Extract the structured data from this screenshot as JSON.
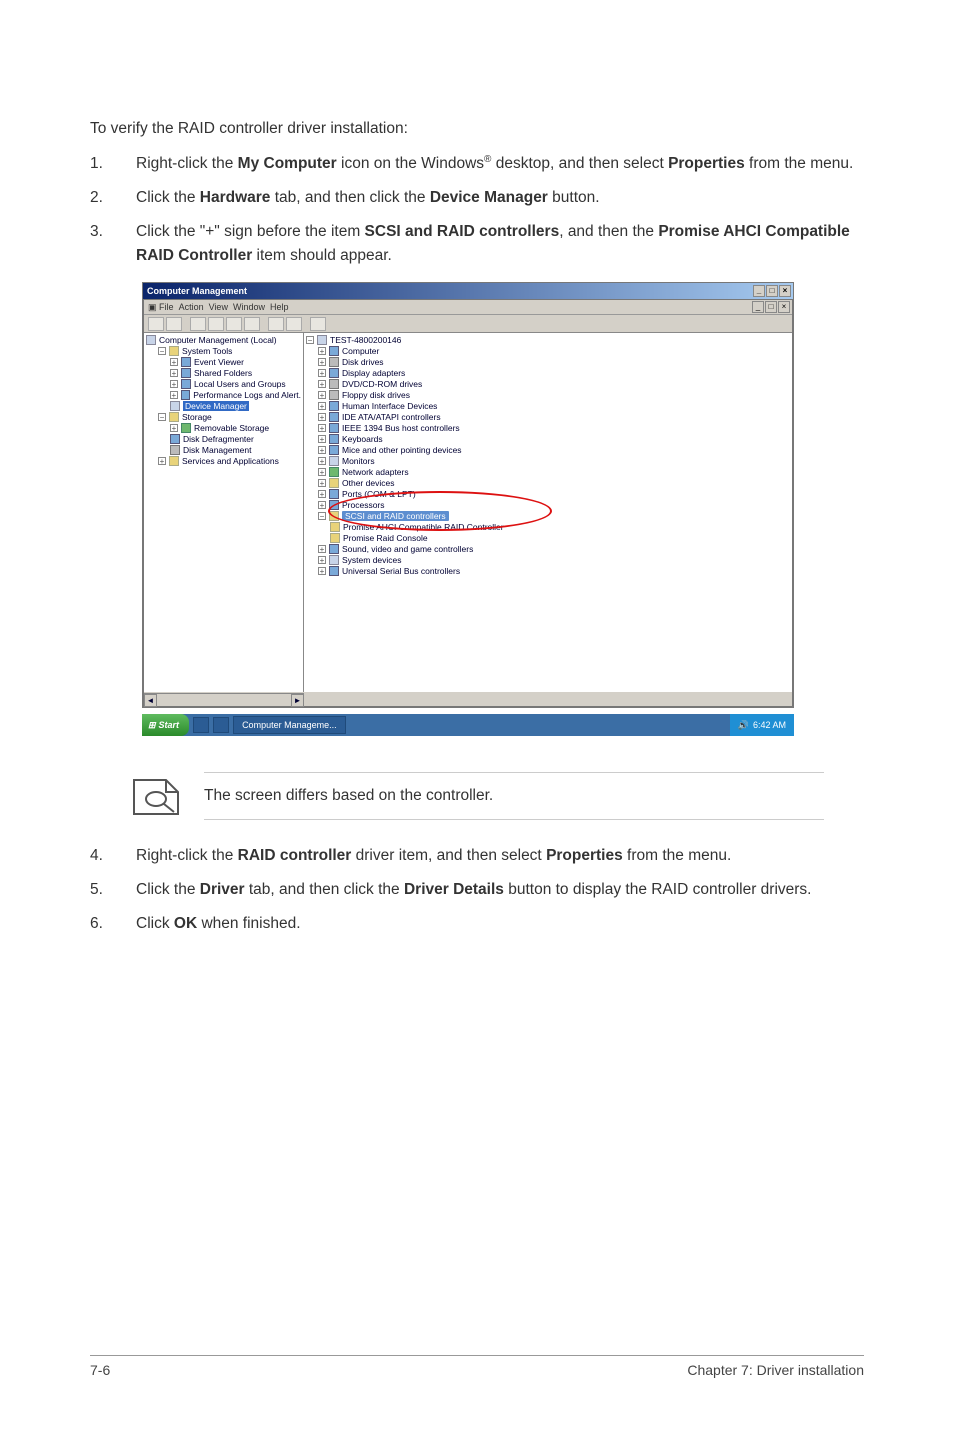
{
  "intro": "To verify the RAID controller driver installation:",
  "steps_a": [
    {
      "num": "1.",
      "body_pre": "Right-click the ",
      "b1": "My Computer",
      "body_mid": " icon on the Windows",
      "sup": "®",
      "body_mid2": " desktop, and then select ",
      "b2": "Properties",
      "body_post": " from the menu."
    },
    {
      "num": "2.",
      "body_pre": "Click the ",
      "b1": "Hardware",
      "body_mid": " tab, and then click the ",
      "b2": "Device Manager",
      "body_post": " button."
    },
    {
      "num": "3.",
      "body_pre": "Click the \"+\" sign before the item ",
      "b1": "SCSI and RAID controllers",
      "body_mid": ", and then the ",
      "b2": "Promise AHCI Compatible RAID Controller",
      "body_post": " item should appear."
    }
  ],
  "window": {
    "title": "Computer Management",
    "inner_title_icon": "▣",
    "menubar": {
      "file": "File",
      "action": "Action",
      "view": "View",
      "window": "Window",
      "help": "Help"
    },
    "left_tree": {
      "root": "Computer Management (Local)",
      "system_tools": "System Tools",
      "event_viewer": "Event Viewer",
      "shared_folders": "Shared Folders",
      "local_users": "Local Users and Groups",
      "perf_logs": "Performance Logs and Alert.",
      "device_manager": "Device Manager",
      "storage": "Storage",
      "removable": "Removable Storage",
      "defrag": "Disk Defragmenter",
      "disk_mgmt": "Disk Management",
      "services": "Services and Applications"
    },
    "right_tree": {
      "root": "TEST-4800200146",
      "items": [
        "Computer",
        "Disk drives",
        "Display adapters",
        "DVD/CD-ROM drives",
        "Floppy disk drives",
        "Human Interface Devices",
        "IDE ATA/ATAPI controllers",
        "IEEE 1394 Bus host controllers",
        "Keyboards",
        "Mice and other pointing devices",
        "Monitors",
        "Network adapters",
        "Other devices",
        "Ports (COM & LPT)",
        "Processors"
      ],
      "scsi": "SCSI and RAID controllers",
      "scsi_children": [
        "Promise AHCI Compatible RAID Controller",
        "Promise Raid Console"
      ],
      "items_after": [
        "Sound, video and game controllers",
        "System devices",
        "Universal Serial Bus controllers"
      ]
    }
  },
  "taskbar": {
    "start": "Start",
    "task1": "Computer Manageme...",
    "clock": "6:42 AM"
  },
  "note": "The screen differs based on the controller.",
  "steps_b": [
    {
      "num": "4.",
      "body_pre": "Right-click the ",
      "b1": "RAID controller",
      "body_mid": " driver item, and then select ",
      "b2": "Properties",
      "body_post": " from the menu."
    },
    {
      "num": "5.",
      "body_pre": "Click the ",
      "b1": "Driver",
      "body_mid": " tab, and then click the ",
      "b2": "Driver Details",
      "body_post": " button to display the RAID controller drivers."
    },
    {
      "num": "6.",
      "body_pre": "Click ",
      "b1": "OK",
      "body_mid": " when finished.",
      "b2": "",
      "body_post": ""
    }
  ],
  "footer": {
    "left": "7-6",
    "right": "Chapter 7: Driver installation"
  }
}
